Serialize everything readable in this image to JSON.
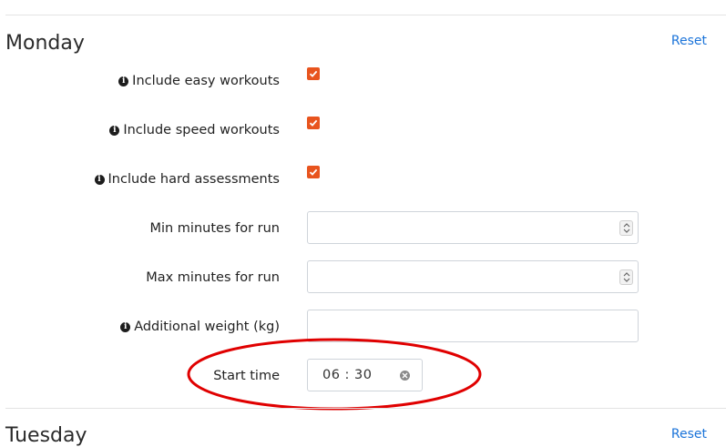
{
  "days": [
    {
      "name": "Monday",
      "reset_label": "Reset",
      "fields": [
        {
          "label": "Include easy workouts",
          "type": "checkbox",
          "checked": true,
          "info": true
        },
        {
          "label": "Include speed workouts",
          "type": "checkbox",
          "checked": true,
          "info": true
        },
        {
          "label": "Include hard assessments",
          "type": "checkbox",
          "checked": true,
          "info": true
        },
        {
          "label": "Min minutes for run",
          "type": "number",
          "value": "",
          "info": false
        },
        {
          "label": "Max minutes for run",
          "type": "number",
          "value": "",
          "info": false
        },
        {
          "label": "Additional weight (kg)",
          "type": "text",
          "value": "",
          "info": true
        },
        {
          "label": "Start time",
          "type": "time",
          "value": "06:30",
          "info": false
        }
      ]
    },
    {
      "name": "Tuesday",
      "reset_label": "Reset"
    }
  ],
  "accent_color": "#e8541e",
  "link_color": "#1a73d9",
  "highlight_color": "#e00000"
}
